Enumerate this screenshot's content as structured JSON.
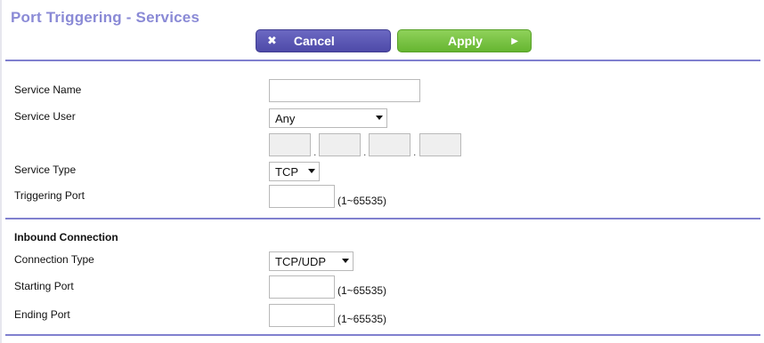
{
  "page": {
    "title": "Port Triggering - Services"
  },
  "buttons": {
    "cancel_label": "Cancel",
    "apply_label": "Apply"
  },
  "icons": {
    "cancel": "close-icon",
    "apply": "arrow-right-icon"
  },
  "form": {
    "service_name": {
      "label": "Service Name",
      "value": ""
    },
    "service_user": {
      "label": "Service User",
      "selected": "Any"
    },
    "ip_address": [
      "",
      "",
      "",
      ""
    ],
    "service_type": {
      "label": "Service Type",
      "selected": "TCP"
    },
    "triggering_port": {
      "label": "Triggering Port",
      "value": "",
      "hint": "(1~65535)"
    }
  },
  "inbound": {
    "heading": "Inbound Connection",
    "connection_type": {
      "label": "Connection Type",
      "selected": "TCP/UDP"
    },
    "starting_port": {
      "label": "Starting Port",
      "value": "",
      "hint": "(1~65535)"
    },
    "ending_port": {
      "label": "Ending Port",
      "value": "",
      "hint": "(1~65535)"
    }
  },
  "colors": {
    "title": "#8a8ad6",
    "cancel_button": "#5552b3",
    "apply_button": "#74c13f",
    "divider": "#8080cf"
  }
}
